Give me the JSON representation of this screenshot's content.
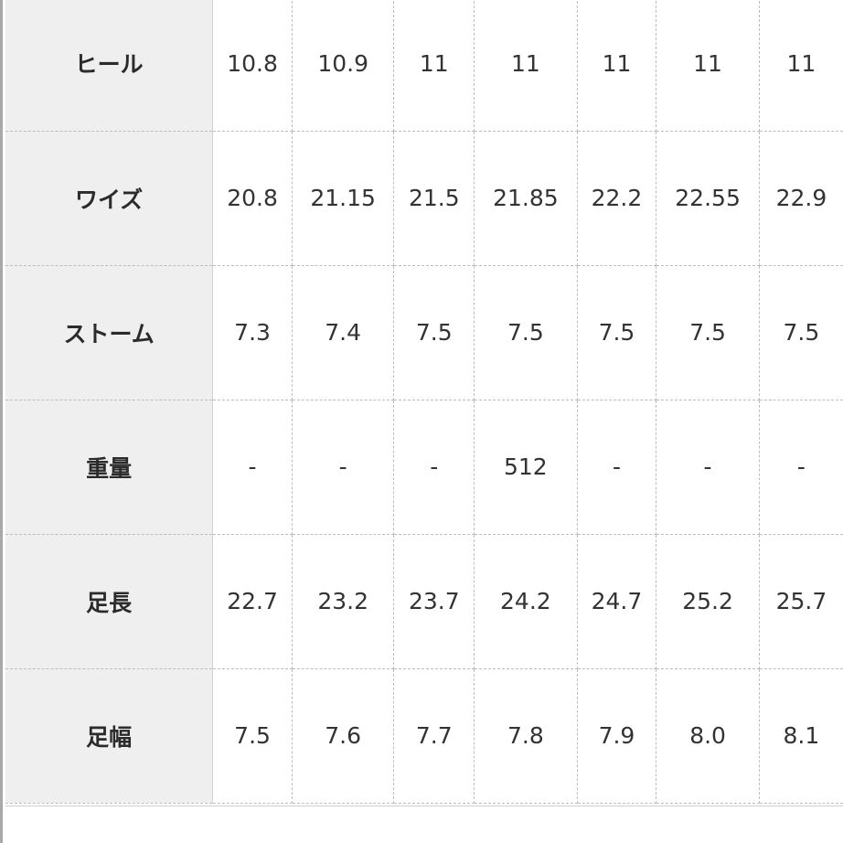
{
  "rows": [
    {
      "label": "ヒール",
      "values": [
        "10.8",
        "10.9",
        "11",
        "11",
        "11",
        "11",
        "11"
      ]
    },
    {
      "label": "ワイズ",
      "values": [
        "20.8",
        "21.15",
        "21.5",
        "21.85",
        "22.2",
        "22.55",
        "22.9"
      ]
    },
    {
      "label": "ストーム",
      "values": [
        "7.3",
        "7.4",
        "7.5",
        "7.5",
        "7.5",
        "7.5",
        "7.5"
      ]
    },
    {
      "label": "重量",
      "values": [
        "-",
        "-",
        "-",
        "512",
        "-",
        "-",
        "-"
      ]
    },
    {
      "label": "足長",
      "values": [
        "22.7",
        "23.2",
        "23.7",
        "24.2",
        "24.7",
        "25.2",
        "25.7"
      ]
    },
    {
      "label": "足幅",
      "values": [
        "7.5",
        "7.6",
        "7.7",
        "7.8",
        "7.9",
        "8.0",
        "8.1"
      ]
    }
  ]
}
